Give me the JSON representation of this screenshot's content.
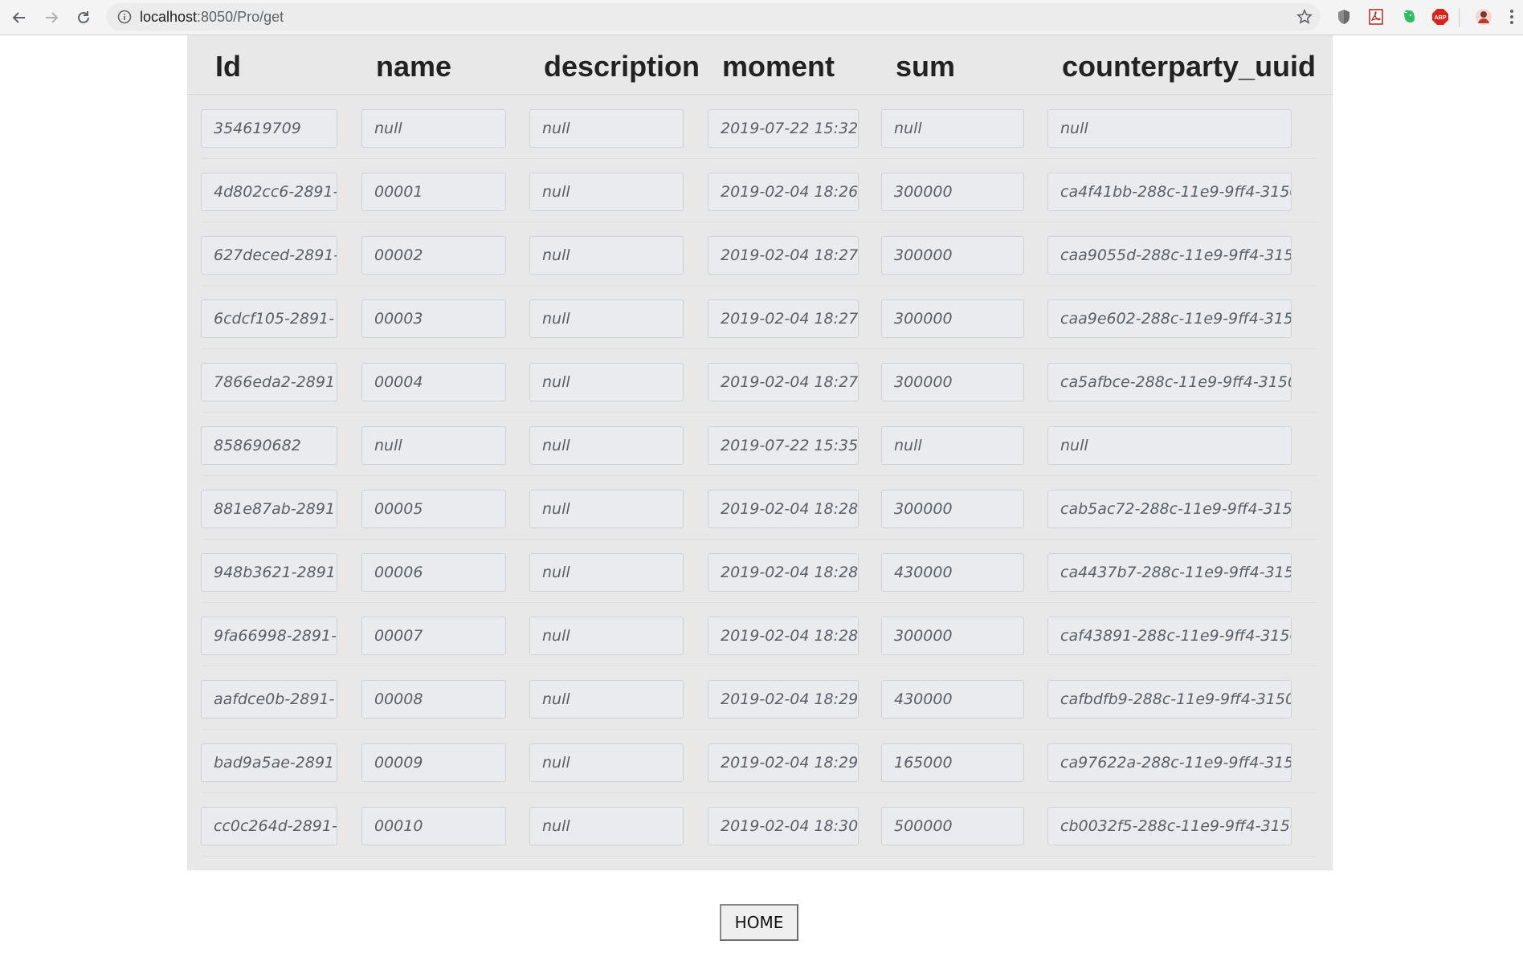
{
  "browser": {
    "url_host": "localhost",
    "url_rest": ":8050/Pro/get"
  },
  "table": {
    "columns": [
      "Id",
      "name",
      "description",
      "moment",
      "sum",
      "counterparty_uuid"
    ],
    "rows": [
      [
        "354619709",
        "null",
        "null",
        "2019-07-22 15:32",
        "null",
        "null"
      ],
      [
        "4d802cc6-2891-",
        "00001",
        "null",
        "2019-02-04 18:26",
        "300000",
        "ca4f41bb-288c-11e9-9ff4-3150"
      ],
      [
        "627deced-2891-",
        "00002",
        "null",
        "2019-02-04 18:27",
        "300000",
        "caa9055d-288c-11e9-9ff4-315("
      ],
      [
        "6cdcf105-2891-",
        "00003",
        "null",
        "2019-02-04 18:27",
        "300000",
        "caa9e602-288c-11e9-9ff4-315("
      ],
      [
        "7866eda2-2891",
        "00004",
        "null",
        "2019-02-04 18:27",
        "300000",
        "ca5afbce-288c-11e9-9ff4-3150("
      ],
      [
        "858690682",
        "null",
        "null",
        "2019-07-22 15:35",
        "null",
        "null"
      ],
      [
        "881e87ab-2891",
        "00005",
        "null",
        "2019-02-04 18:28",
        "300000",
        "cab5ac72-288c-11e9-9ff4-315("
      ],
      [
        "948b3621-2891",
        "00006",
        "null",
        "2019-02-04 18:28",
        "430000",
        "ca4437b7-288c-11e9-9ff4-315("
      ],
      [
        "9fa66998-2891-",
        "00007",
        "null",
        "2019-02-04 18:28",
        "300000",
        "caf43891-288c-11e9-9ff4-3150"
      ],
      [
        "aafdce0b-2891-",
        "00008",
        "null",
        "2019-02-04 18:29",
        "430000",
        "cafbdfb9-288c-11e9-9ff4-3150("
      ],
      [
        "bad9a5ae-2891",
        "00009",
        "null",
        "2019-02-04 18:29",
        "165000",
        "ca97622a-288c-11e9-9ff4-315("
      ],
      [
        "cc0c264d-2891-",
        "00010",
        "null",
        "2019-02-04 18:30",
        "500000",
        "cb0032f5-288c-11e9-9ff4-3150"
      ]
    ]
  },
  "home_button": {
    "label": "HOME"
  },
  "icons": {
    "back": "arrow-left-icon",
    "forward": "arrow-right-icon",
    "reload": "reload-icon",
    "info": "info-icon",
    "bookmark": "star-icon",
    "extensions": [
      "shield-icon",
      "pdf-icon",
      "evernote-icon",
      "adblock-icon"
    ],
    "profile": "avatar-icon",
    "menu": "kebab-menu-icon"
  },
  "colors": {
    "panel_bg": "#e8e8e8",
    "cell_bg": "#e9ebee",
    "cell_border": "#cfd3d8",
    "cell_text": "#595f66",
    "header_text": "#222222"
  }
}
